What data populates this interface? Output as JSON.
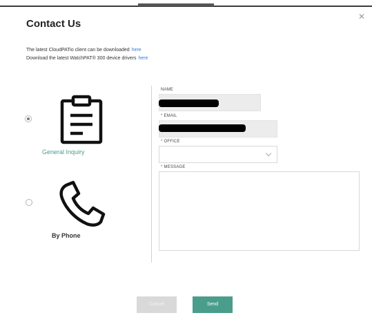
{
  "dialog": {
    "title": "Contact Us",
    "info_line1": "The latest CloudPATio client can be downloaded",
    "info_line1_link": "here",
    "info_line2": "Download the latest WatchPAT® 300 device drivers",
    "info_line2_link": "here"
  },
  "options": {
    "general_inquiry": {
      "label": "General Inquiry",
      "selected": true
    },
    "by_phone": {
      "label": "By Phone",
      "selected": false
    }
  },
  "form": {
    "name_label": "NAME",
    "email_label": "EMAIL",
    "office_label": "OFFICE",
    "message_label": "MESSAGE",
    "required_marker": "*",
    "office_value": "",
    "message_value": ""
  },
  "buttons": {
    "cancel_label": "Cancel",
    "send_label": "Send"
  },
  "colors": {
    "accent": "#4a9d8a",
    "link": "#3a7bd5",
    "required": "#d32f2f"
  }
}
